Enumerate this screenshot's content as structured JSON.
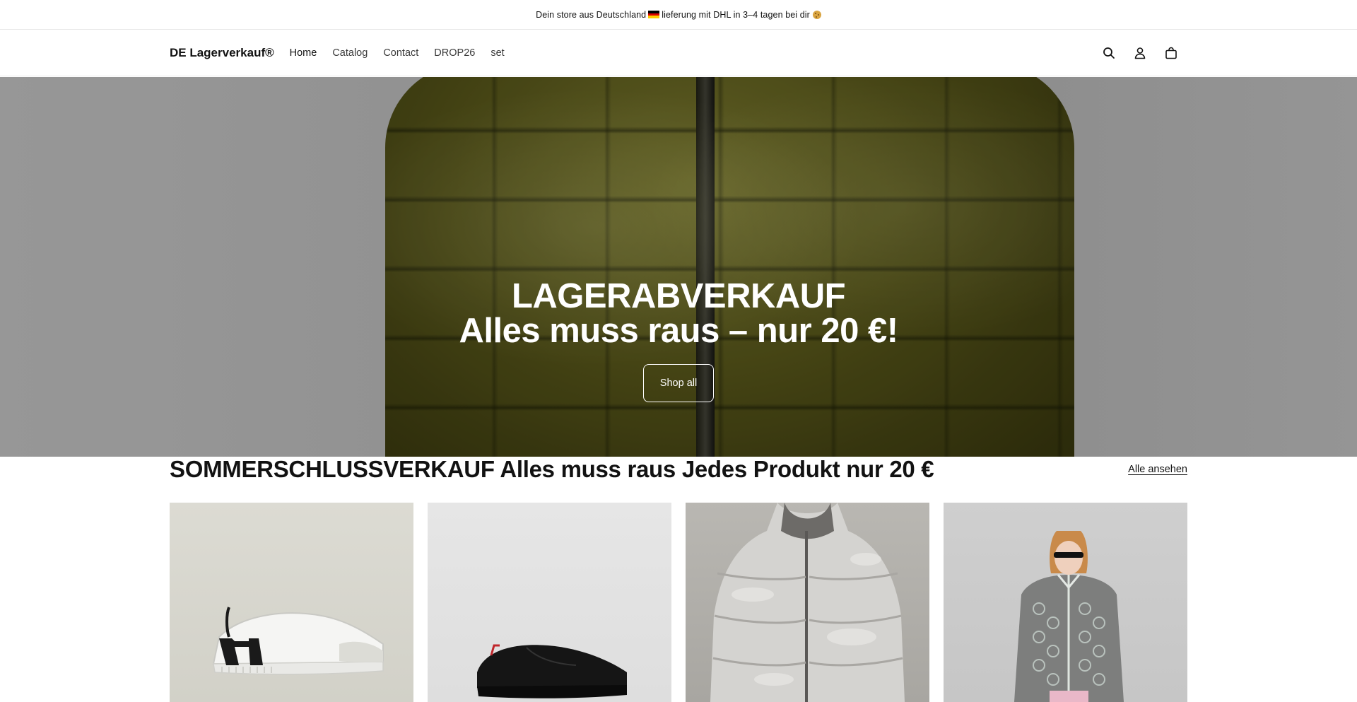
{
  "announcement": {
    "text_before": "Dein store aus Deutschland",
    "text_after": "lieferung mit DHL in 3–4 tagen bei dir"
  },
  "header": {
    "logo": "DE Lagerverkauf®",
    "nav": [
      {
        "label": "Home",
        "active": true
      },
      {
        "label": "Catalog"
      },
      {
        "label": "Contact"
      },
      {
        "label": "DROP26"
      },
      {
        "label": "set"
      }
    ],
    "icons": [
      "search-icon",
      "account-icon",
      "cart-icon"
    ]
  },
  "hero": {
    "title": "LAGERABVERKAUF",
    "subtitle": "Alles muss raus – nur 20 €!",
    "button_label": "Shop all"
  },
  "collection": {
    "title": "SOMMERSCHLUSSVERKAUF Alles muss raus Jedes Produkt nur 20 €",
    "view_all_label": "Alle ansehen",
    "products": [
      {
        "image": "white sneaker with black H heel"
      },
      {
        "image": "black sneaker"
      },
      {
        "image": "grey camo puffer jacket"
      },
      {
        "image": "model in grey monogram knit zip jacket"
      }
    ]
  },
  "colors": {
    "text": "#121212",
    "hero_text": "#ffffff",
    "border": "#e6e6e6"
  }
}
